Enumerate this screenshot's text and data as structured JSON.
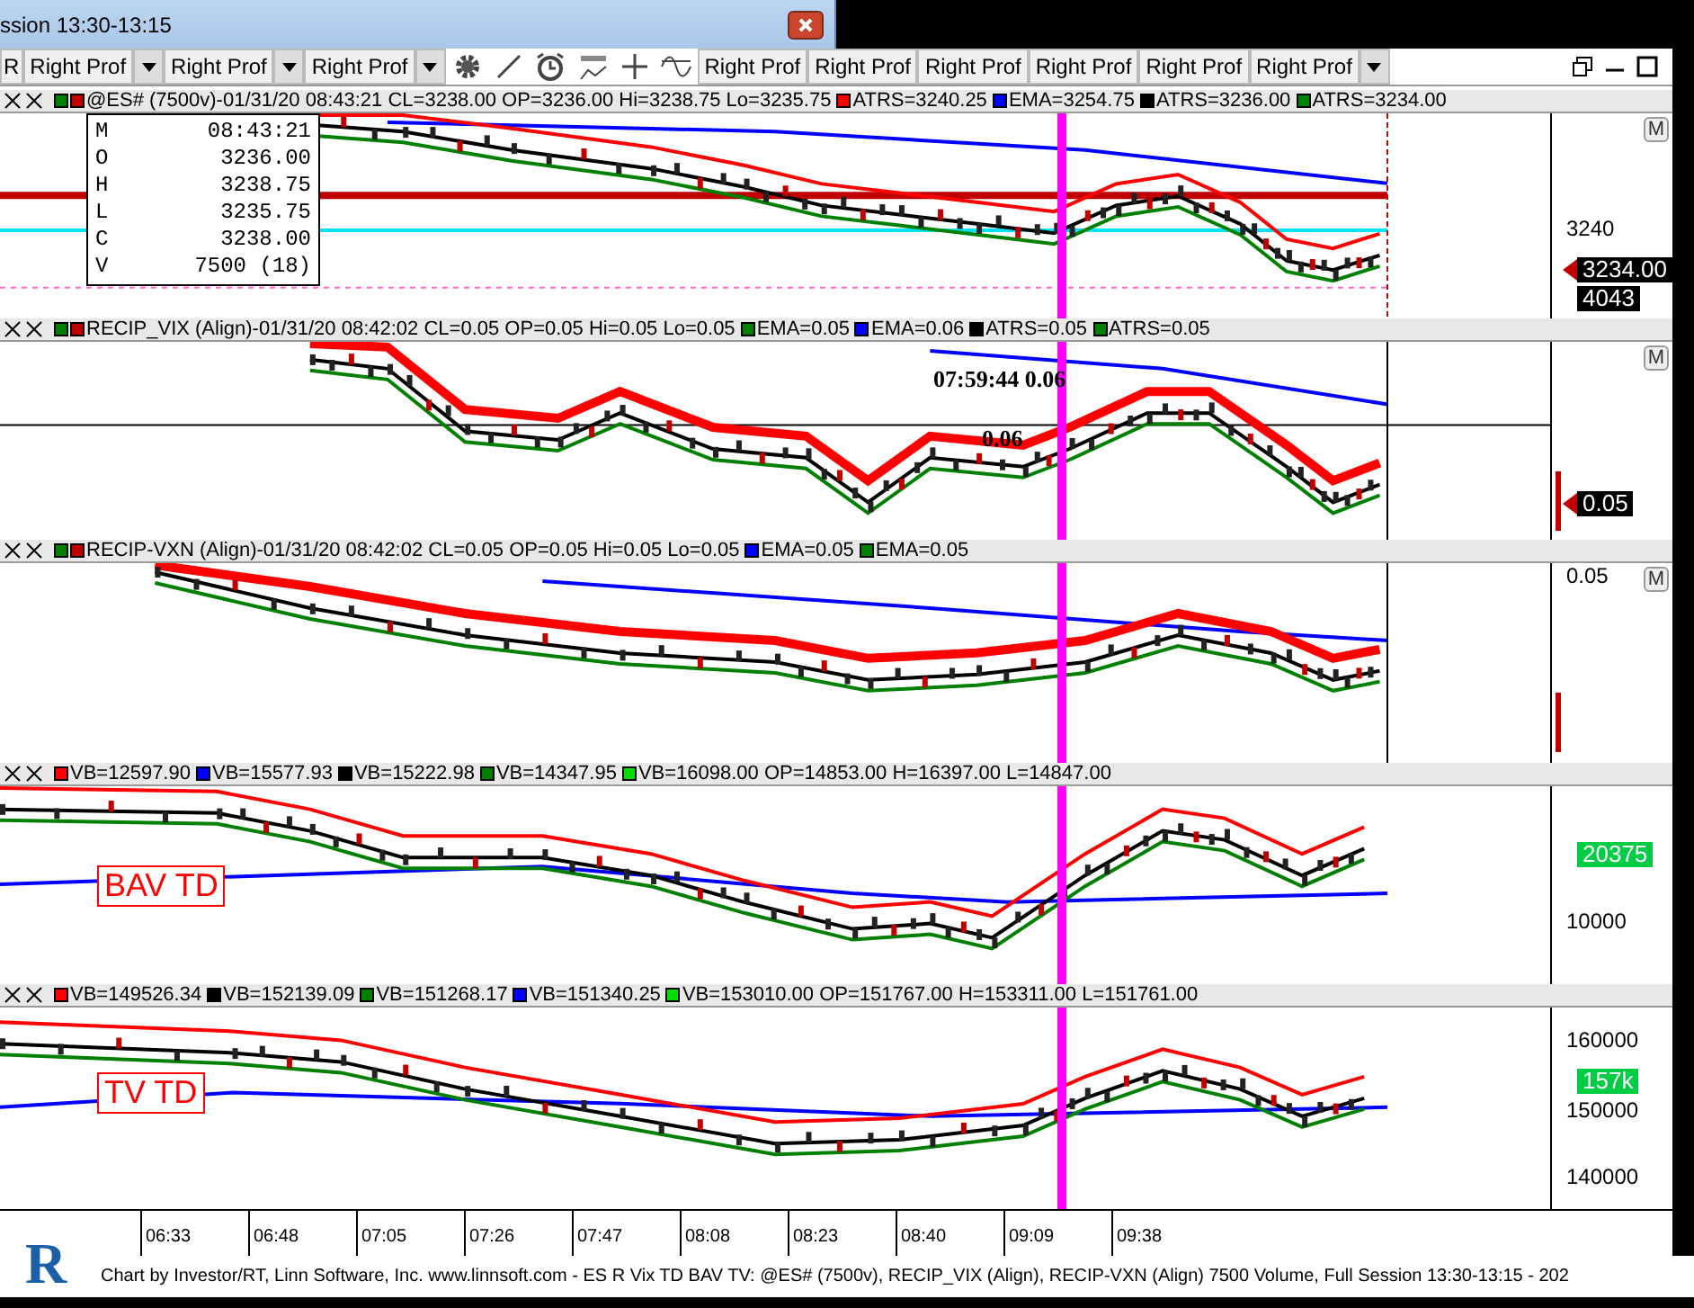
{
  "title_bar": {
    "title": "ssion 13:30-13:15"
  },
  "toolbar": {
    "cut_label": "R",
    "dropdowns": [
      {
        "label": "Right Prof"
      },
      {
        "label": "Right Prof"
      },
      {
        "label": "Right Prof"
      }
    ],
    "buttons": [
      {
        "label": "Right Prof"
      },
      {
        "label": "Right Prof"
      },
      {
        "label": "Right Prof"
      },
      {
        "label": "Right Prof"
      },
      {
        "label": "Right Prof"
      },
      {
        "label": "Right Prof"
      }
    ],
    "overflow_menu": true
  },
  "panes": [
    {
      "legend": [
        {
          "swatches": [
            {
              "color": "#008000"
            },
            {
              "color": "#c00000"
            }
          ],
          "text": "@ES# (7500v)-01/31/20 08:43:21 CL=3238.00 OP=3236.00 Hi=3238.75 Lo=3235.75"
        },
        {
          "swatches": [
            {
              "color": "#ff0000"
            }
          ],
          "text": "ATRS=3240.25"
        },
        {
          "swatches": [
            {
              "color": "#0000ff"
            }
          ],
          "text": "EMA=3254.75"
        },
        {
          "swatches": [
            {
              "color": "#000000"
            }
          ],
          "text": "ATRS=3236.00"
        },
        {
          "swatches": [
            {
              "color": "#008000"
            }
          ],
          "text": "ATRS=3234.00"
        }
      ],
      "menu_button": "M",
      "tooltip": [
        {
          "key": "M",
          "value": "08:43:21"
        },
        {
          "key": "O",
          "value": "3236.00"
        },
        {
          "key": "H",
          "value": "3238.75"
        },
        {
          "key": "L",
          "value": "3235.75"
        },
        {
          "key": "C",
          "value": "3238.00"
        },
        {
          "key": "V",
          "value": "7500 (18)"
        }
      ],
      "axis": [
        {
          "kind": "tick",
          "text": "3240"
        },
        {
          "kind": "badge",
          "text": "3234.00",
          "color": "#000000"
        },
        {
          "kind": "badge",
          "text": "4043",
          "color": "#000000"
        }
      ]
    },
    {
      "legend": [
        {
          "swatches": [
            {
              "color": "#008000"
            },
            {
              "color": "#c00000"
            }
          ],
          "text": "RECIP_VIX (Align)-01/31/20 08:42:02 CL=0.05 OP=0.05 Hi=0.05 Lo=0.05"
        },
        {
          "swatches": [
            {
              "color": "#008000"
            }
          ],
          "text": "EMA=0.05"
        },
        {
          "swatches": [
            {
              "color": "#0000ff"
            }
          ],
          "text": "EMA=0.06"
        },
        {
          "swatches": [
            {
              "color": "#000000"
            }
          ],
          "text": "ATRS=0.05"
        },
        {
          "swatches": [
            {
              "color": "#008000"
            }
          ],
          "text": "ATRS=0.05"
        }
      ],
      "menu_button": "M",
      "notes": [
        "07:59:44 0.06",
        "0.06"
      ],
      "axis": [
        {
          "kind": "badge",
          "text": "0.05",
          "color": "#000000"
        }
      ]
    },
    {
      "legend": [
        {
          "swatches": [
            {
              "color": "#008000"
            },
            {
              "color": "#c00000"
            }
          ],
          "text": "RECIP-VXN (Align)-01/31/20 08:42:02 CL=0.05 OP=0.05 Hi=0.05 Lo=0.05"
        },
        {
          "swatches": [
            {
              "color": "#0000ff"
            }
          ],
          "text": "EMA=0.05"
        },
        {
          "swatches": [
            {
              "color": "#008000"
            }
          ],
          "text": "EMA=0.05"
        }
      ],
      "menu_button": "M",
      "axis": [
        {
          "kind": "tick",
          "text": "0.05"
        }
      ]
    },
    {
      "legend": [
        {
          "swatches": [
            {
              "color": "#ff0000"
            }
          ],
          "text": "VB=12597.90"
        },
        {
          "swatches": [
            {
              "color": "#0000ff"
            }
          ],
          "text": "VB=15577.93"
        },
        {
          "swatches": [
            {
              "color": "#000000"
            }
          ],
          "text": "VB=15222.98"
        },
        {
          "swatches": [
            {
              "color": "#008000"
            }
          ],
          "text": "VB=14347.95"
        },
        {
          "swatches": [
            {
              "color": "#00e000"
            }
          ],
          "text": "VB=16098.00 OP=14853.00 H=16397.00 L=14847.00"
        }
      ],
      "label": "BAV TD",
      "axis": [
        {
          "kind": "badge",
          "text": "20375",
          "color": "#00cc44"
        },
        {
          "kind": "tick",
          "text": "10000"
        }
      ]
    },
    {
      "legend": [
        {
          "swatches": [
            {
              "color": "#ff0000"
            }
          ],
          "text": "VB=149526.34"
        },
        {
          "swatches": [
            {
              "color": "#000000"
            }
          ],
          "text": "VB=152139.09"
        },
        {
          "swatches": [
            {
              "color": "#008000"
            }
          ],
          "text": "VB=151268.17"
        },
        {
          "swatches": [
            {
              "color": "#0000ff"
            }
          ],
          "text": "VB=151340.25"
        },
        {
          "swatches": [
            {
              "color": "#00e000"
            }
          ],
          "text": "VB=153010.00 OP=151767.00 H=153311.00 L=151761.00"
        }
      ],
      "label": "TV TD",
      "axis": [
        {
          "kind": "tick",
          "text": "160000"
        },
        {
          "kind": "badge",
          "text": "157k",
          "color": "#00cc44"
        },
        {
          "kind": "tick",
          "text": "150000"
        },
        {
          "kind": "tick",
          "text": "140000"
        }
      ]
    }
  ],
  "time_axis": [
    "06:33",
    "06:48",
    "07:05",
    "07:26",
    "07:47",
    "08:08",
    "08:23",
    "08:40",
    "09:09",
    "09:38"
  ],
  "footer": {
    "logo": "R",
    "text": "Chart by Investor/RT, Linn Software, Inc. www.linnsoft.com - ES R Vix TD BAV TV: @ES# (7500v), RECIP_VIX (Align), RECIP-VXN (Align) 7500 Volume, Full Session 13:30-13:15 - 202"
  }
}
